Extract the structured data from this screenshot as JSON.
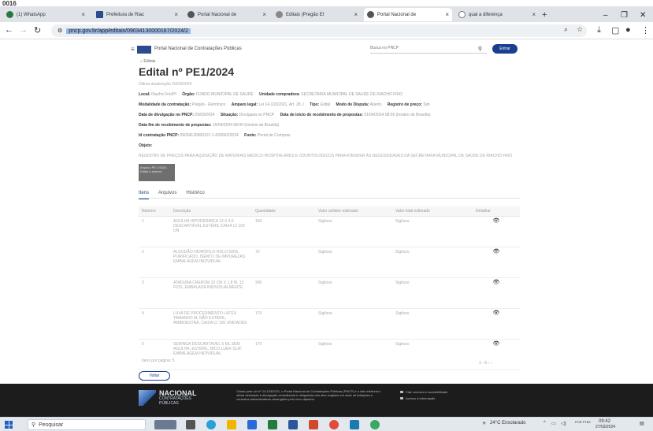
{
  "top_label": "0016",
  "browser": {
    "tabs": [
      {
        "label": "(1) WhatsApp",
        "active": false
      },
      {
        "label": "Prefeitura de Riac",
        "active": false
      },
      {
        "label": "Portal Nacional de",
        "active": false
      },
      {
        "label": "Editais (Pregão El",
        "active": false
      },
      {
        "label": "Portal Nacional de",
        "active": true
      },
      {
        "label": "qual a diferença",
        "active": false
      }
    ],
    "new_tab": "+",
    "url": "pncp.gov.br/app/editais/09034130000167/2024/2"
  },
  "site": {
    "title": "Portal Nacional de Contratações Públicas",
    "search_placeholder": "Busca no PNCP",
    "login_label": "Entrar"
  },
  "page": {
    "breadcrumb": "Editais",
    "edital_title": "Edital nº PE1/2024",
    "last_update": "Última atualização 29/03/2024",
    "info_rows": [
      [
        {
          "label": "Local:",
          "value": "Riacho Frio/PI"
        },
        {
          "label": "Órgão:",
          "value": "FUNDO MUNICIPAL DE SAUDE"
        },
        {
          "label": "Unidade compradora:",
          "value": "SECRETARIA MUNICIPAL DE SAUDE DE RIACHO FRIO"
        }
      ],
      [
        {
          "label": "Modalidade da contratação:",
          "value": "Pregão - Eletrônico"
        },
        {
          "label": "Amparo legal:",
          "value": "Lei 14.133/2021, Art. 28, I"
        },
        {
          "label": "Tipo:",
          "value": "Edital"
        },
        {
          "label": "Modo de Disputa:",
          "value": "Aberto"
        },
        {
          "label": "Registro de preço:",
          "value": "Sim"
        }
      ],
      [
        {
          "label": "Data de divulgação no PNCP:",
          "value": "29/03/2024"
        },
        {
          "label": "Situação:",
          "value": "Divulgada no PNCP"
        },
        {
          "label": "Data de início de recebimento de propostas:",
          "value": "01/04/2024 08:00 (horário de Brasília)"
        }
      ],
      [
        {
          "label": "Data fim de recebimento de propostas:",
          "value": "15/04/2024 08:00 (horário de Brasília)"
        }
      ],
      [
        {
          "label": "Id contratação PNCP:",
          "value": "09034130000167-1-000002/2024"
        },
        {
          "label": "Fonte:",
          "value": "Portal de Compras"
        }
      ]
    ],
    "objeto_label": "Objeto:",
    "objeto_text": "REGISTRO DE PREÇOS PARA AQUISIÇÃO DE MATERIAIS MÉDICO-HOSPITALARES E ODONTOLÓGICOS PARA ATENDER ÀS NECESSIDADES DA SECRETARIA MUNICIPAL DE SAÚDE DE RIACHO FRIO",
    "document_card": "Arquivo PE 1/2024 - Edital e anexos",
    "sub_tabs": [
      "Itens",
      "Arquivos",
      "Histórico"
    ],
    "table": {
      "headers": [
        "Número",
        "Descrição",
        "Quantidade",
        "Valor unitário estimado",
        "Valor total estimado",
        "Detalhar"
      ],
      "rows": [
        [
          "1",
          "AGULHA HIPODÉRMICA 13 X 4,5 DESCARTÁVEL ESTÉRIL CAIXA C/ 100 UN",
          "150",
          "Sigiloso",
          "Sigiloso",
          "👁"
        ],
        [
          "2",
          "ALGODÃO HIDRÓFILO ROLO 500G, PURIFICADO, ISENTO DE IMPUREZAS EMBALAGEM INDIVIDUAL",
          "70",
          "Sigiloso",
          "Sigiloso",
          "👁"
        ],
        [
          "3",
          "ATADURA CREPOM 10 CM X 1,8 M, 13 FIOS, EMBALADA INDIVIDUALMENTE",
          "200",
          "Sigiloso",
          "Sigiloso",
          "👁"
        ],
        [
          "4",
          "LUVA DE PROCEDIMENTO LÁTEX TAMANHO M, NÃO ESTÉRIL, AMBIDESTRA, CAIXA C/ 100 UNIDADES",
          "170",
          "Sigiloso",
          "Sigiloso",
          "👁"
        ],
        [
          "5",
          "SERINGA DESCARTÁVEL 5 ML SEM AGULHA, ESTÉRIL, BICO LUER SLIP, EMBALAGEM INDIVIDUAL",
          "170",
          "Sigiloso",
          "Sigiloso",
          "👁"
        ]
      ]
    },
    "pager": "Itens por página: 5",
    "pager_nav": "1 - 5  ‹  ›",
    "back_button": "Voltar"
  },
  "footer": {
    "brand_line1": "NACIONAL",
    "brand_line2": "CONTRATAÇÕES",
    "brand_line3": "PÚBLICAS",
    "text": "Criado pela Lei nº 14.133/2021, o Portal Nacional de Contratações Públicas (PNCP) é o sítio eletrônico oficial destinado à divulgação centralizada e obrigatória dos atos exigidos em sede de licitações e contratos administrativos abrangidos pelo novo diploma.",
    "links": [
      "Fale conosco e acessibilidade",
      "Acesso à informação"
    ]
  },
  "taskbar": {
    "search_placeholder": "Pesquisar",
    "weather": "24°C Ensolarado",
    "lang": "POR PTB2",
    "time": "09:42",
    "date": "27/03/2024"
  },
  "colors": {
    "brand_blue": "#1a3f8f",
    "footer_bg": "#1c1c1c",
    "tab_strip": "#dfe3e8"
  }
}
